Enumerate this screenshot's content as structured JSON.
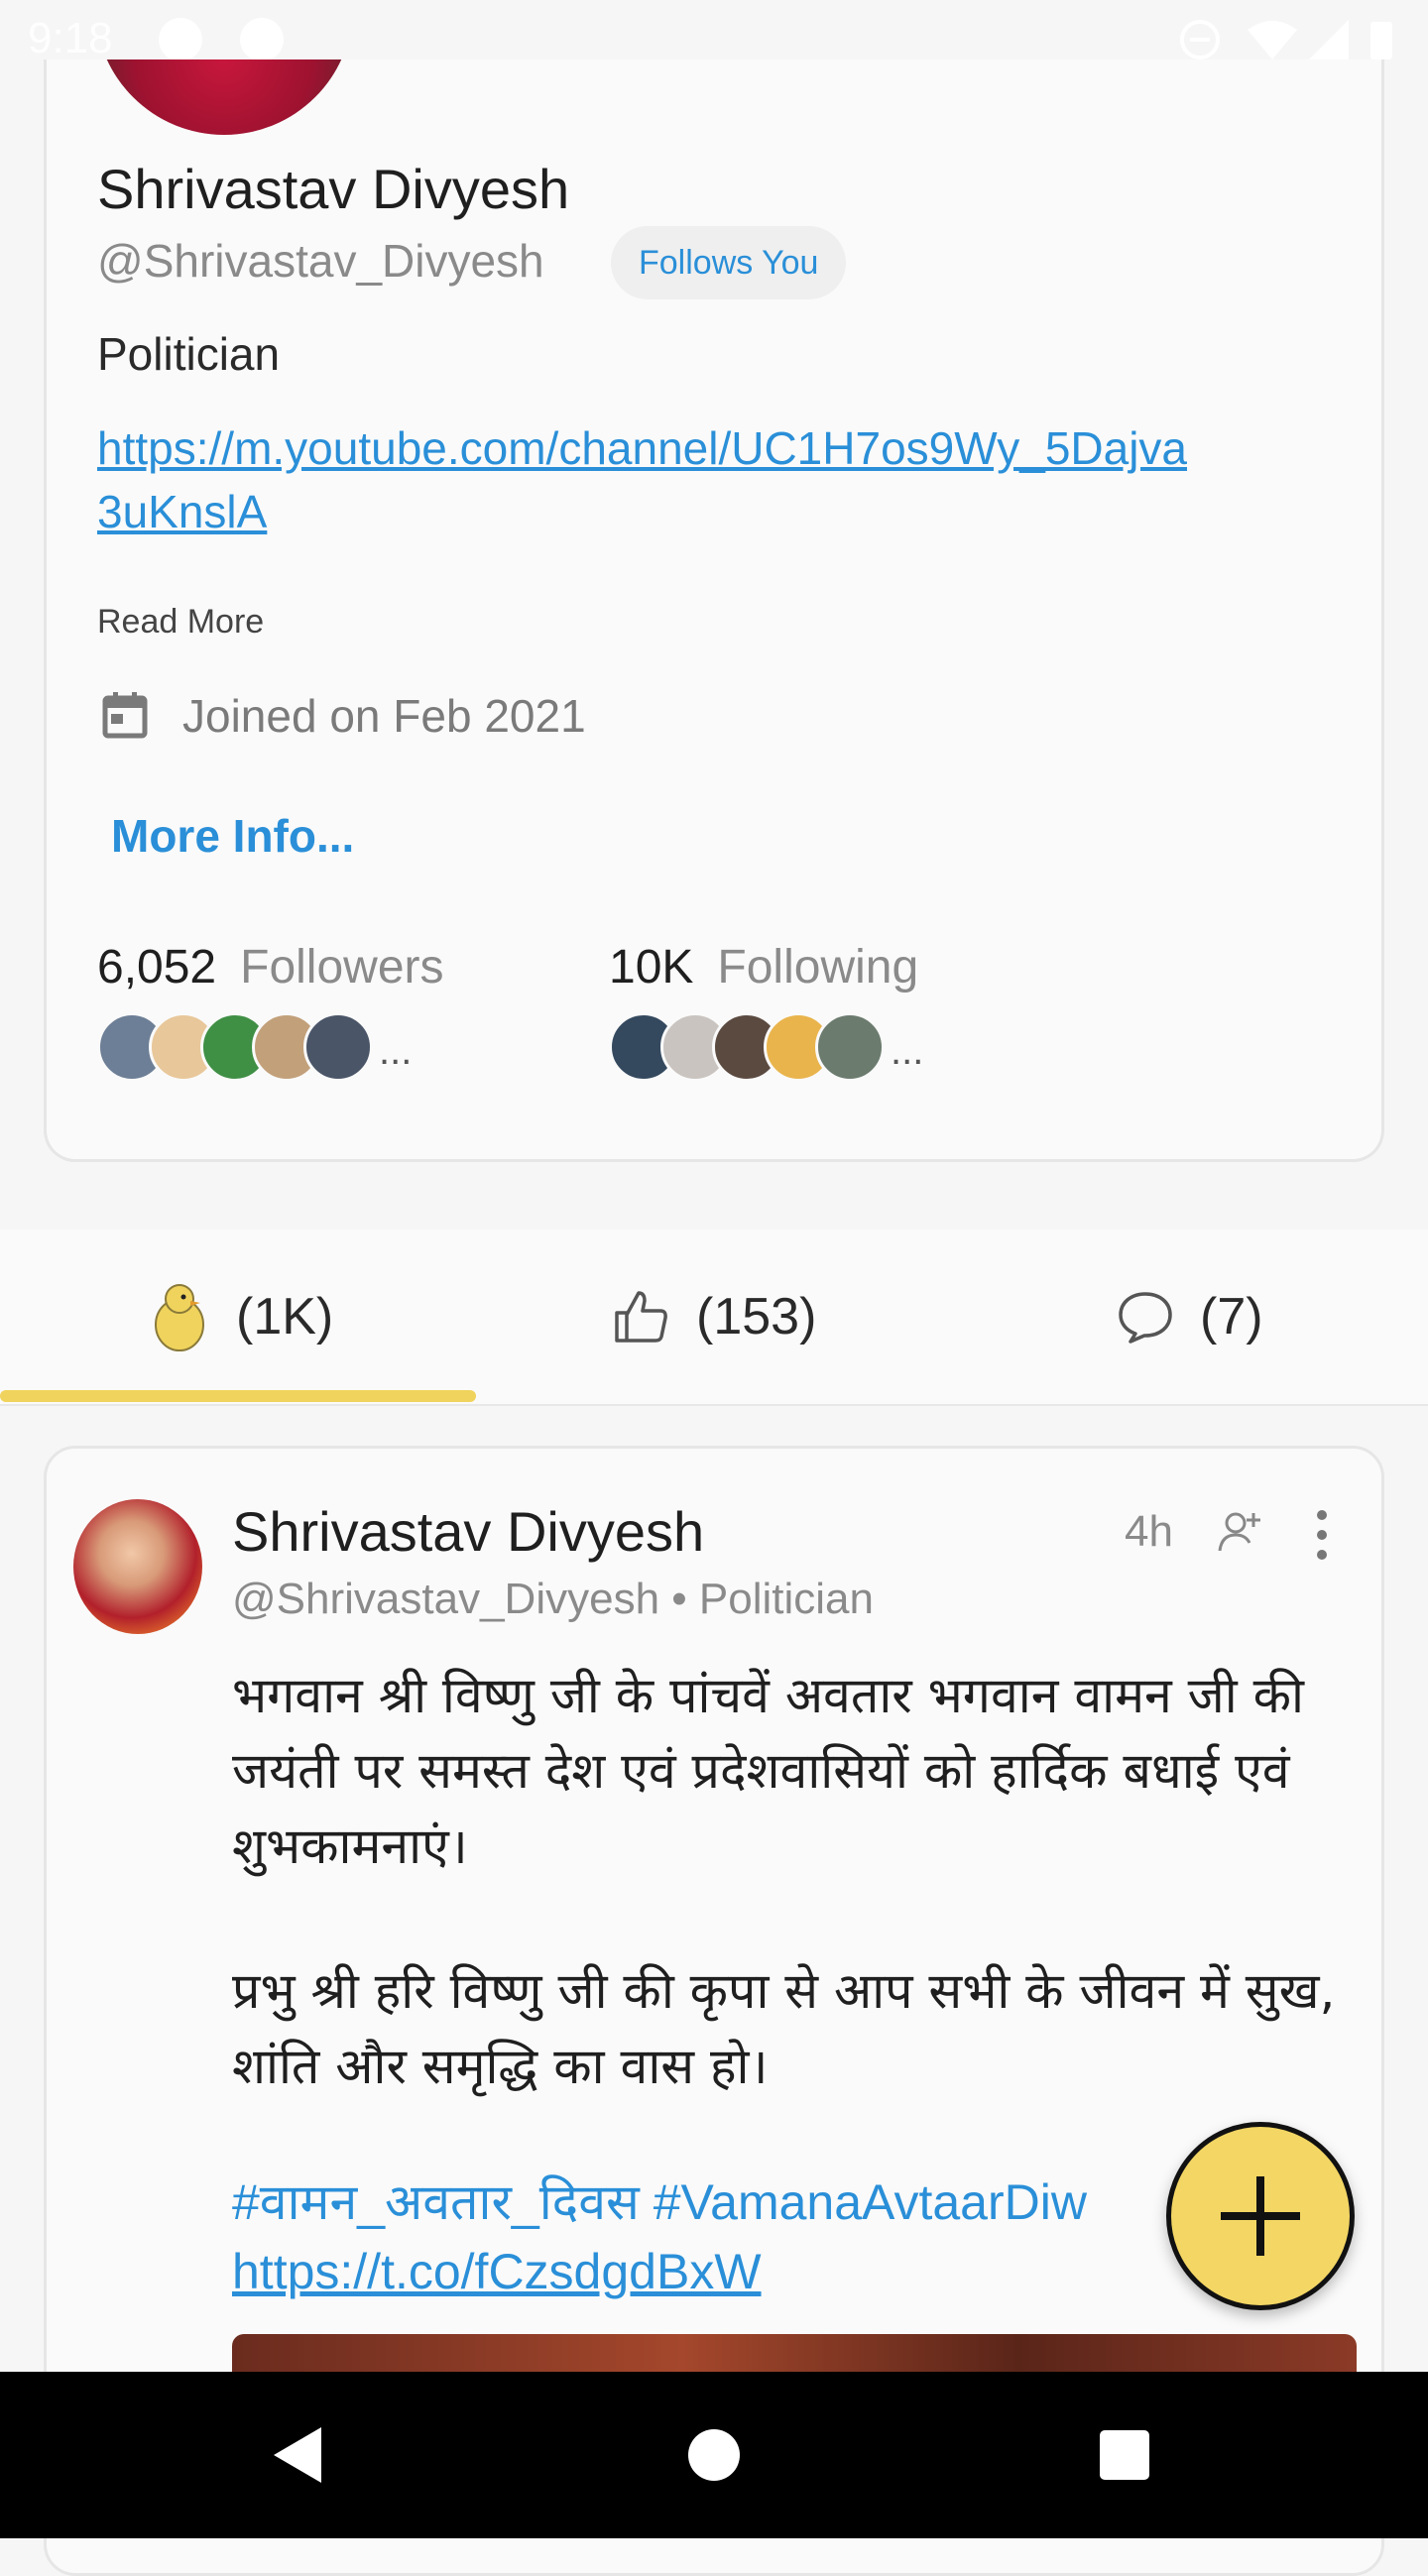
{
  "status_bar": {
    "time": "9:18"
  },
  "profile": {
    "name": "Shrivastav Divyesh",
    "handle": "@Shrivastav_Divyesh",
    "follows_badge": "Follows You",
    "bio": "Politician",
    "link": "https://m.youtube.com/channel/UC1H7os9Wy_5Dajva3uKnslA",
    "read_more": "Read More",
    "joined": "Joined on Feb 2021",
    "more_info": "More Info...",
    "followers": {
      "count": "6,052",
      "label": "Followers",
      "ellipsis": "..."
    },
    "following": {
      "count": "10K",
      "label": "Following",
      "ellipsis": "..."
    }
  },
  "tabs": [
    {
      "icon": "koo-bird-icon",
      "label": "(1K)"
    },
    {
      "icon": "thumbs-up-icon",
      "label": "(153)"
    },
    {
      "icon": "comment-icon",
      "label": "(7)"
    }
  ],
  "post": {
    "author": "Shrivastav Divyesh",
    "meta": "@Shrivastav_Divyesh • Politician",
    "time": "4h",
    "paragraph1": "भगवान श्री विष्णु जी के पांचवें अवतार भगवान वामन जी की जयंती पर समस्त देश एवं प्रदेशवासियों को हार्दिक बधाई एवं शुभकामनाएं।",
    "paragraph2": "प्रभु श्री हरि विष्णु जी की कृपा से आप सभी के जीवन में सुख, शांति और समृद्धि का वास हो।",
    "hashtags": "#वामन_अवतार_दिवस #VamanaAvtaarDiw",
    "short_link": "https://t.co/fCzsdgdBxW"
  },
  "colors": {
    "accent_yellow": "#f3d664",
    "link_blue": "#2a8fd8",
    "muted_text": "#8a8a8a"
  }
}
